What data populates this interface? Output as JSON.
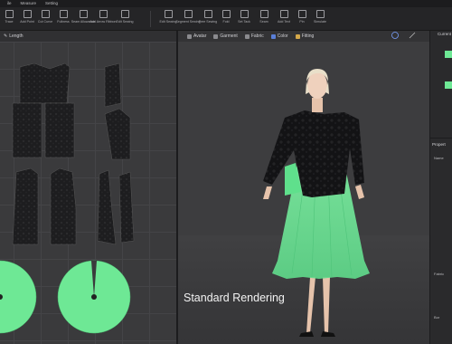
{
  "menu": {
    "items": [
      "ile",
      "Measure",
      "Setting"
    ]
  },
  "toolbar": {
    "tools": [
      "Trace",
      "Add Point",
      "Cut Curve",
      "Fullness",
      "Seam Allowance",
      "Add Arrow Ribbon",
      "Edit Sewing",
      "Edit Sewing",
      "Segment Sewing",
      "Free Sewing",
      "Fold",
      "Set Tack",
      "Seam",
      "Add Text",
      "Pin",
      "Simulate"
    ]
  },
  "panel2d": {
    "length_label": "Length"
  },
  "panel3d": {
    "tabs": [
      {
        "label": "Avatar",
        "color": "#8a8a8e"
      },
      {
        "label": "Garment",
        "color": "#8a8a8e"
      },
      {
        "label": "Fabric",
        "color": "#8a8a8e"
      },
      {
        "label": "Color",
        "color": "#5a7fd8"
      },
      {
        "label": "Fitting",
        "color": "#d4a84a"
      }
    ],
    "caption": "Standard Rendering"
  },
  "right_panel": {
    "header": "Current",
    "property_header": "Propert",
    "section_1": "Name",
    "section_2": "Fabric",
    "section_3": "Bor"
  },
  "colors": {
    "accent_green": "#6ee895",
    "jacket": "#111113",
    "piece_dark": "#1e1e20"
  }
}
